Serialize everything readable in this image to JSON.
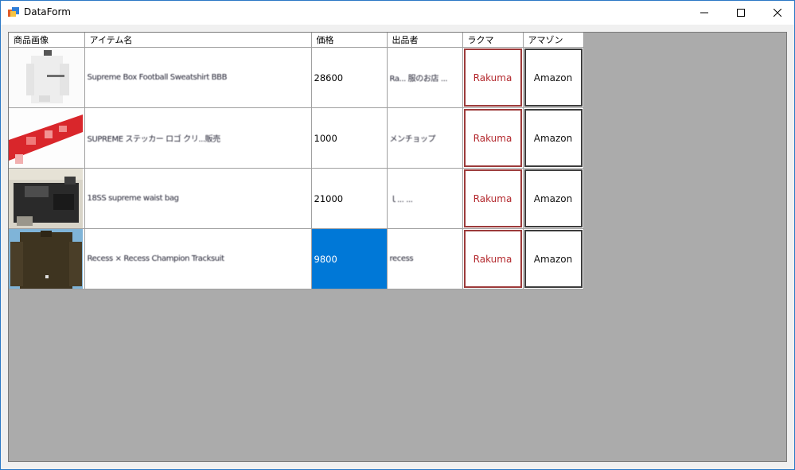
{
  "window": {
    "title": "DataForm"
  },
  "columns": [
    "商品画像",
    "アイテム名",
    "価格",
    "出品者",
    "ラクマ",
    "アマゾン"
  ],
  "rows": [
    {
      "item": "Supreme Box Football Sweatshirt BBB",
      "price": "28600",
      "seller": "Ra... 服のお店 ...",
      "rakuma": "Rakuma",
      "amazon": "Amazon",
      "image_desc": "white-hoodie"
    },
    {
      "item": "SUPREME ステッカー ロゴ クリ...販売",
      "price": "1000",
      "seller": "メンチョップ",
      "rakuma": "Rakuma",
      "amazon": "Amazon",
      "image_desc": "red-sticker"
    },
    {
      "item": "18SS supreme waist bag",
      "price": "21000",
      "seller": "ｌ... ...",
      "rakuma": "Rakuma",
      "amazon": "Amazon",
      "image_desc": "black-bag"
    },
    {
      "item": "Recess × Recess Champion Tracksuit",
      "price": "9800",
      "seller": "recess",
      "rakuma": "Rakuma",
      "amazon": "Amazon",
      "image_desc": "brown-jacket",
      "selected": true
    }
  ]
}
